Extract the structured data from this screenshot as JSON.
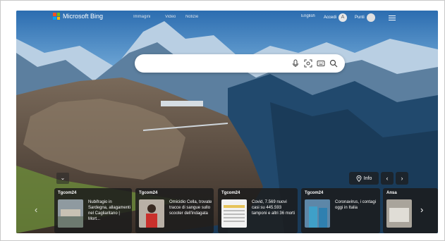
{
  "header": {
    "brand": "Microsoft Bing",
    "nav": [
      "Immagini",
      "Video",
      "Notizie"
    ],
    "language": "English",
    "signin_label": "Accedi",
    "avatar_glyph": "A",
    "points_label": "Punti"
  },
  "search": {
    "placeholder": ""
  },
  "controls": {
    "info_label": "Info",
    "collapse_glyph": "⌄",
    "prev_glyph": "‹",
    "next_glyph": "›",
    "carousel_next_glyph": "›",
    "carousel_prev_glyph": "‹"
  },
  "news": [
    {
      "source": "Tgcom24",
      "headline": "Nubifragio in Sardegna, allagamenti nel Cagliaritano | Mort..."
    },
    {
      "source": "Tgcom24",
      "headline": "Omicidio Cella, trovate tracce di sangue sullo scooter dell'indagata"
    },
    {
      "source": "Tgcom24",
      "headline": "Covid, 7.569 nuovi casi su 445.593 tamponi e altri 36 morti"
    },
    {
      "source": "Tgcom24",
      "headline": "Coronavirus, i contagi oggi in Italia"
    },
    {
      "source": "Ansa",
      "headline": ""
    }
  ],
  "colors": {
    "logo_red": "#f25022",
    "logo_green": "#7fba00",
    "logo_blue": "#00a4ef",
    "logo_yellow": "#ffb900"
  }
}
